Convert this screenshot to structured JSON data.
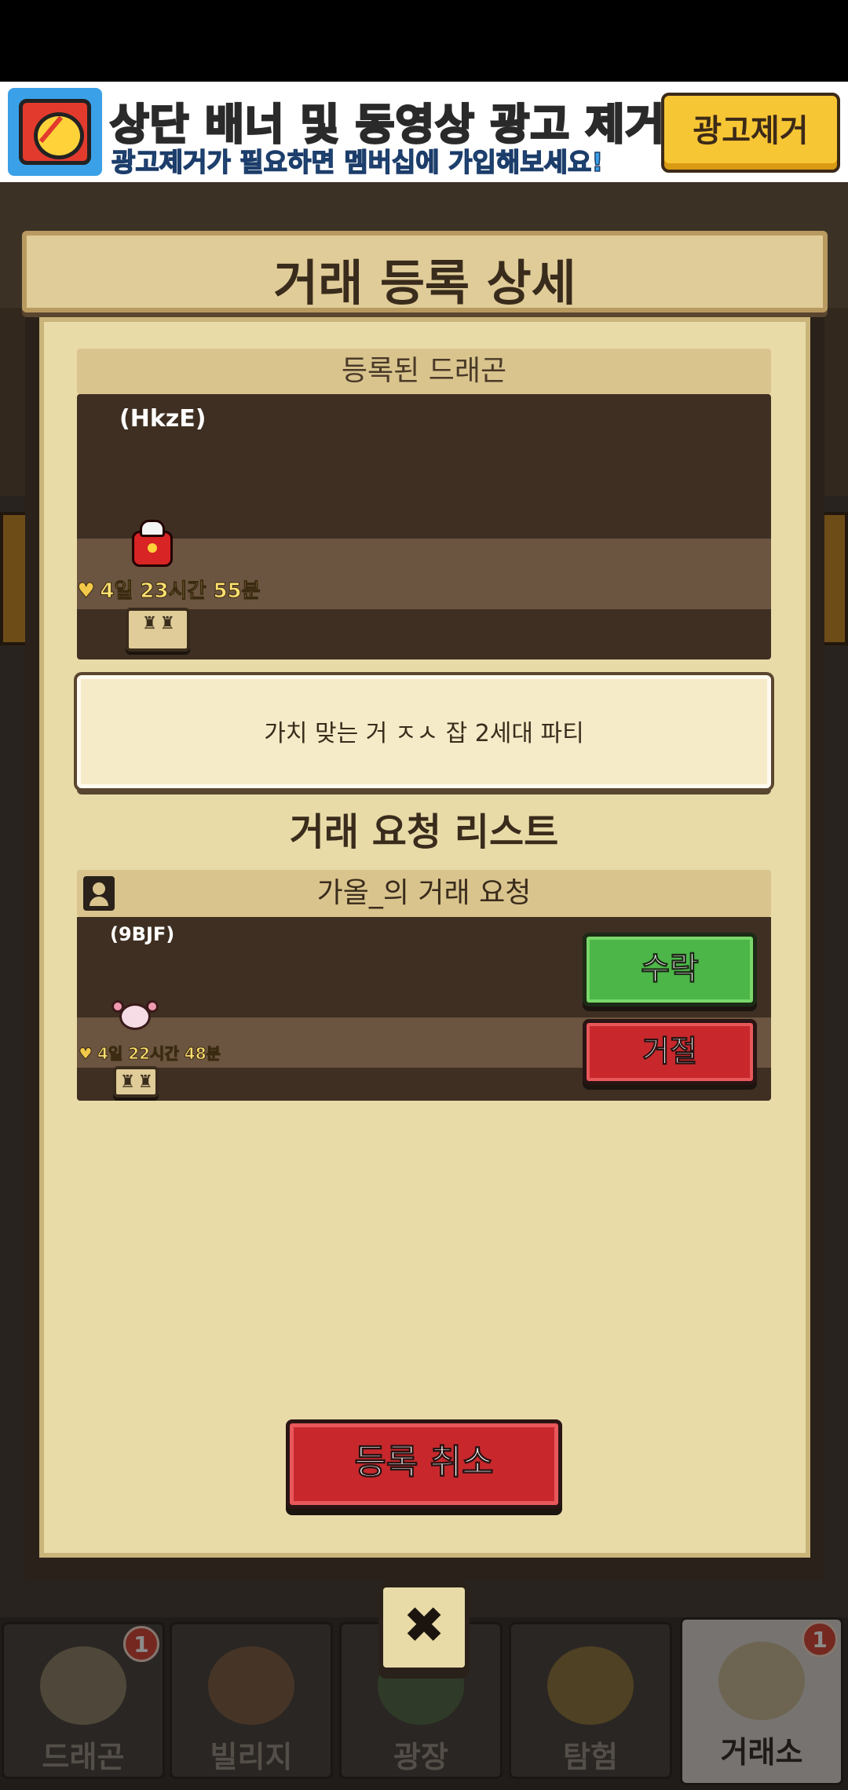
{
  "ad": {
    "title": "상단 배너 및 동영상 광고 제거!",
    "subtitle": "광고제거가 필요하면 멤버십에 가입해보세요!",
    "remove_button": "광고제거",
    "icon": "no-ads-tv-icon"
  },
  "dialog": {
    "title": "거래 등록 상세",
    "registered_section": "등록된 드래곤",
    "registered_dragon": {
      "code": "(HkzE)",
      "timer": "4일 23시간 55분"
    },
    "description": "가치 맞는 거 ㅈㅅ 잡 2세대 파티",
    "request_list_heading": "거래 요청 리스트",
    "requests": [
      {
        "header": "가올_의 거래 요청",
        "dragon_code": "(9BJF)",
        "timer": "4일 22시간 48분",
        "accept_label": "수락",
        "reject_label": "거절"
      }
    ],
    "cancel_label": "등록 취소",
    "close_symbol": "✖"
  },
  "bottom_nav": {
    "items": [
      {
        "label": "드래곤",
        "badge": "1",
        "icon": "dragon-icon"
      },
      {
        "label": "빌리지",
        "badge": "",
        "icon": "village-icon"
      },
      {
        "label": "광장",
        "badge": "",
        "icon": "plaza-icon"
      },
      {
        "label": "탐험",
        "badge": "",
        "icon": "compass-icon"
      },
      {
        "label": "거래소",
        "badge": "1",
        "icon": "trade-icon",
        "active": true
      }
    ]
  },
  "colors": {
    "accept": "#4cb648",
    "reject": "#c8282c",
    "panel": "#e8dba8",
    "ad_accent": "#f7c634"
  }
}
